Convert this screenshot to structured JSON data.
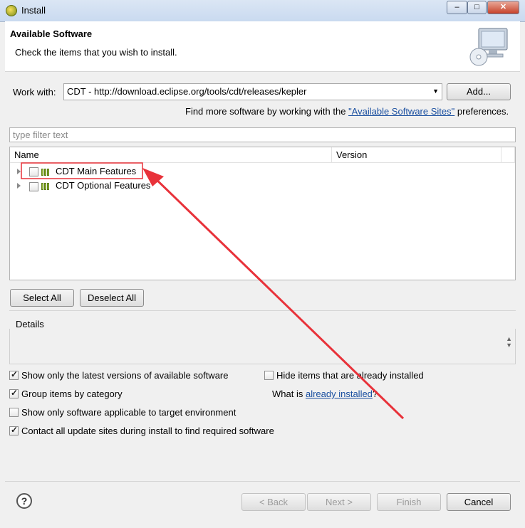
{
  "window": {
    "title": "Install",
    "minimize": "‒",
    "maximize": "□",
    "close": "✕"
  },
  "header": {
    "title": "Available Software",
    "subtitle": "Check the items that you wish to install.",
    "icon": "monitor-cd-icon"
  },
  "work_with": {
    "label": "Work with:",
    "value": "CDT - http://download.eclipse.org/tools/cdt/releases/kepler",
    "add_label": "Add...",
    "find_prefix": "Find more software by working with the",
    "find_link": "\"Available Software Sites\"",
    "find_suffix": "preferences."
  },
  "filter": {
    "placeholder": "type filter text"
  },
  "table": {
    "columns": [
      "Name",
      "Version"
    ],
    "rows": [
      {
        "label": "CDT Main Features",
        "checked": false,
        "highlighted": true
      },
      {
        "label": "CDT Optional Features",
        "checked": false,
        "highlighted": false
      }
    ]
  },
  "buttons": {
    "select_all": "Select All",
    "deselect_all": "Deselect All"
  },
  "details": {
    "label": "Details"
  },
  "options": {
    "latest_versions": {
      "label": "Show only the latest versions of available software",
      "checked": true
    },
    "group_category": {
      "label": "Group items by category",
      "checked": true
    },
    "applicable_target": {
      "label": "Show only software applicable to target environment",
      "checked": false
    },
    "contact_sites": {
      "label": "Contact all update sites during install to find required software",
      "checked": true
    },
    "hide_installed": {
      "label": "Hide items that are already installed",
      "checked": false
    },
    "what_is_prefix": "What is",
    "what_is_link": "already installed",
    "what_is_suffix": "?"
  },
  "footer": {
    "help": "?",
    "back": "< Back",
    "next": "Next >",
    "finish": "Finish",
    "cancel": "Cancel"
  },
  "annotation": {
    "color": "#e8323a"
  }
}
